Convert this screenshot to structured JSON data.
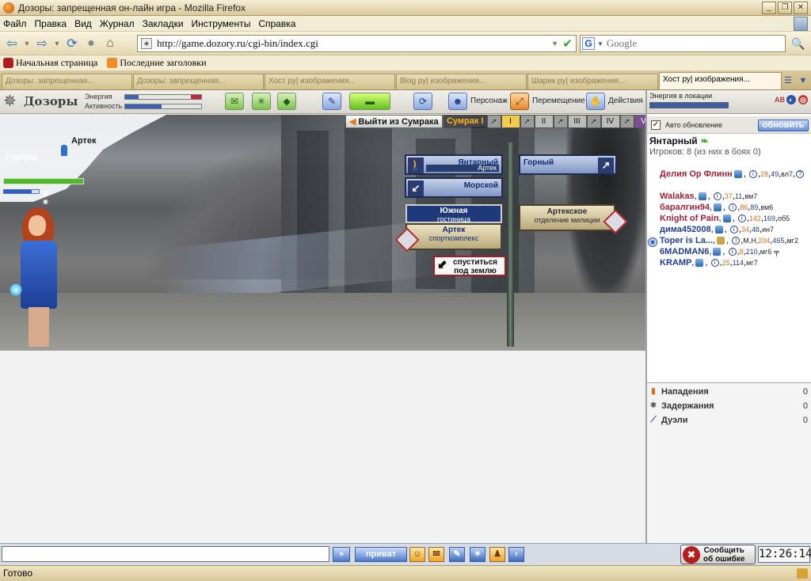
{
  "browser": {
    "title": "Дозоры: запрещенная он-лайн игра - Mozilla Firefox",
    "menu": [
      "Файл",
      "Правка",
      "Вид",
      "Журнал",
      "Закладки",
      "Инструменты",
      "Справка"
    ],
    "url": "http://game.dozory.ru/cgi-bin/index.cgi",
    "search_placeholder": "Google",
    "bookmarks": [
      "Начальная страница",
      "Последние заголовки"
    ],
    "tabs": [
      "Дозоры: запрещенная...",
      "Дозоры: запрещенная...",
      "Хост ру| изображения...",
      "Blog ру| изображения...",
      "Шарик ру| изображения...",
      "Хост ру| изображения..."
    ],
    "status": "Готово"
  },
  "game": {
    "logo": "Дозоры",
    "energy_label": "Энергия",
    "activity_label": "Активность",
    "energy_pct": 0.18,
    "activity_pct": 0.48,
    "nav": {
      "person": "Персонаж",
      "move": "Перемещение",
      "actions": "Действия"
    },
    "exit_twilight": "Выйти из Сумрака",
    "twilight_label": "Сумрак I",
    "twilight_levels": [
      "I",
      "II",
      "III",
      "IV",
      "V"
    ],
    "map": {
      "region1": "Гурзуф",
      "region2": "Артек"
    },
    "signs": {
      "s1_main": "Янтарный",
      "s1_sub": "Артек",
      "s2_main": "Горный",
      "s3_main": "Морской",
      "s4_main": "Южная",
      "s4_sub": "гостиница",
      "s5_main": "Артек",
      "s5_sub": "спорткомплекс",
      "s6_main": "Артекское",
      "s6_sub": "отделение милиции",
      "descend_1": "спуститься",
      "descend_2": "под землю"
    }
  },
  "panel": {
    "loc_energy_label": "Энергия в локации",
    "auto_refresh": "Авто обновление",
    "refresh_btn": "обновить",
    "location": "Янтарный",
    "players": "Игроков: 8 (из них в боях 0)",
    "list": [
      {
        "name": "Делия Ор Флинн",
        "n1": "28",
        "n2": "49",
        "grp": "вл7",
        "color": "red",
        "q": "?"
      },
      {
        "name": "Walakas",
        "n1": "37",
        "n2": "11",
        "grp": "вм7",
        "color": "red",
        "q": ""
      },
      {
        "name": "баралгин94",
        "n1": "86",
        "n2": "89",
        "grp": "вм6",
        "color": "red",
        "q": ""
      },
      {
        "name": "Knight of Pain",
        "n1": "142",
        "n2": "169",
        "grp": "об5",
        "color": "red",
        "q": ""
      },
      {
        "name": "дима452008",
        "n1": "34",
        "n2": "48",
        "grp": "ин7",
        "color": "blue",
        "q": ""
      },
      {
        "name": "Toper is La...",
        "n1": "204",
        "n2": "465",
        "grp": "мг2",
        "color": "blue",
        "q": "M,H,"
      },
      {
        "name": "6MADMAN6",
        "n1": "8",
        "n2": "210",
        "grp": "мг6",
        "color": "blue",
        "q": ""
      },
      {
        "name": "KRAMP",
        "n1": "25",
        "n2": "114",
        "grp": "мг7",
        "color": "blue",
        "q": ""
      }
    ],
    "events": [
      {
        "label": "Нападения",
        "value": "0"
      },
      {
        "label": "Задержания",
        "value": "0"
      },
      {
        "label": "Дуэли",
        "value": "0"
      }
    ]
  },
  "chat": {
    "private_btn": "приват",
    "report_1": "Сообщить",
    "report_2": "об ошибке",
    "time": "12:26:14"
  },
  "colors": {
    "accent_blue": "#3b5fa3",
    "twilight_yellow": "#ffb21f",
    "enemy_red": "#a0223a",
    "ally_blue": "#1f3d8f"
  }
}
